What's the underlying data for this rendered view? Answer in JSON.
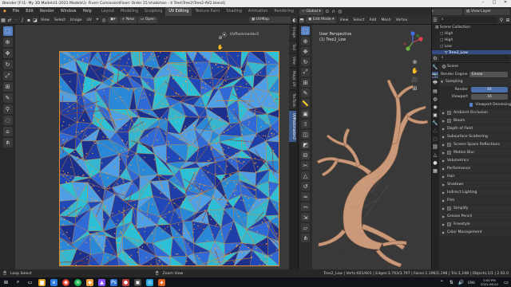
{
  "window": {
    "title": "Blender [F:\\1- My 3D Models\\1-2021 Models\\1- Fiverr Comission\\Fiverr Order 15 khakkhan - 4 Tree\\Tree2\\Tree2-AV2.blend]",
    "minimize": "–",
    "maximize": "□",
    "close": "✕"
  },
  "menu": {
    "logo": "◆",
    "items": [
      "File",
      "Edit",
      "Render",
      "Window",
      "Help"
    ],
    "workspaces": [
      "Layout",
      "Modeling",
      "Sculpting",
      "UV Editing",
      "Texture Paint",
      "Shading",
      "Animation",
      "Rendering",
      "Compositing",
      "Scripting"
    ],
    "active_workspace": "UV Editing",
    "scene": "Scene",
    "view_layer": "View Layer"
  },
  "uv_editor": {
    "header": {
      "view": "View",
      "select": "Select",
      "image": "Image",
      "uv": "UV",
      "new": "New",
      "open": "Open",
      "uvmap": "UVMap"
    },
    "overlay_label": "UVPackmaster2",
    "side_tabs": [
      "Image",
      "Tool",
      "View",
      "Magic UV",
      "TexTools",
      "UVPackmaster2"
    ],
    "active_tab": "UVPackmaster2"
  },
  "viewport": {
    "header": {
      "mode": "Edit Mode",
      "view": "View",
      "select": "Select",
      "add": "Add",
      "mesh": "Mesh",
      "vertex": "Vertex",
      "global": "Global"
    },
    "info_line1": "User Perspective",
    "info_line2": "(1) Tree2_Low"
  },
  "outliner": {
    "title": "Scene Collection",
    "rows": [
      "Scene Collection",
      "High",
      "High",
      "Low",
      "Tree2_Low"
    ],
    "selected_index": 4
  },
  "properties": {
    "scene_label": "Scene",
    "render_engine_label": "Render Engine",
    "render_engine": "Eevee",
    "sampling": "Sampling",
    "render_label": "Render",
    "render_value": "64",
    "viewport_label": "Viewport",
    "viewport_value": "16",
    "viewport_denoising": "Viewport Denoising",
    "panels": [
      {
        "label": "Ambient Occlusion",
        "check": true
      },
      {
        "label": "Bloom",
        "check": true
      },
      {
        "label": "Depth of Field",
        "check": false
      },
      {
        "label": "Subsurface Scattering",
        "check": false
      },
      {
        "label": "Screen Space Reflections",
        "check": true
      },
      {
        "label": "Motion Blur",
        "check": true
      },
      {
        "label": "Volumetrics",
        "check": false
      },
      {
        "label": "Performance",
        "check": false
      },
      {
        "label": "Hair",
        "check": false
      },
      {
        "label": "Shadows",
        "check": false
      },
      {
        "label": "Indirect Lighting",
        "check": false
      },
      {
        "label": "Film",
        "check": false
      },
      {
        "label": "Simplify",
        "check": true
      },
      {
        "label": "Grease Pencil",
        "check": false
      },
      {
        "label": "Freestyle",
        "check": true
      },
      {
        "label": "Color Management",
        "check": false
      }
    ]
  },
  "statusbar": {
    "left": "Loop Select",
    "middle": "Zoom View",
    "stats": "Tree2_Low | Verts:601/601 | Edges:3,793/3,797 | Faces:1,196/1,198 | Tris:1,198 | Objects:1/1 | 2.92.0"
  },
  "taskbar": {
    "time": "5:00 PM",
    "date": "2021-06-02",
    "lang": "ENG"
  },
  "colors": {
    "uv_orange": "#e08a2c",
    "uv_blue_dark": "#1e3fa8",
    "uv_blue": "#2f6ad6",
    "uv_cyan": "#37b6cf",
    "tree_tan": "#c89a76",
    "accent": "#5680c2"
  }
}
